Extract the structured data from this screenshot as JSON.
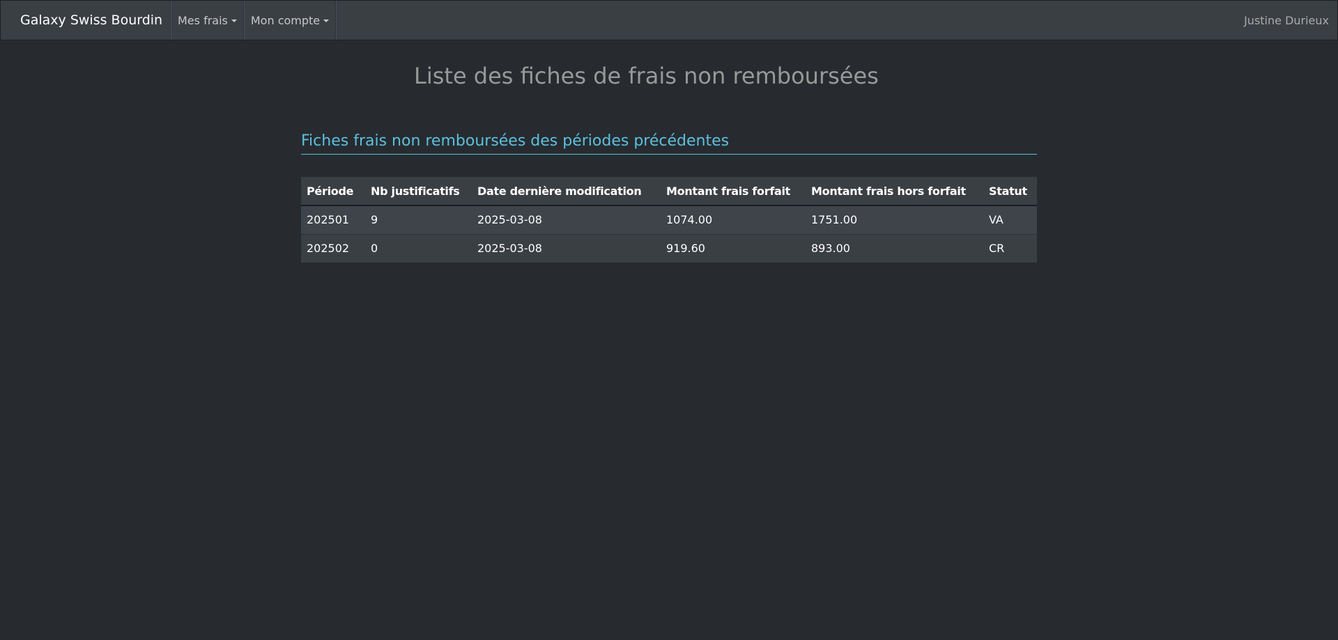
{
  "navbar": {
    "brand": "Galaxy Swiss Bourdin",
    "menus": [
      {
        "label": "Mes frais"
      },
      {
        "label": "Mon compte"
      }
    ],
    "user": "Justine Durieux"
  },
  "page": {
    "title": "Liste des fiches de frais non remboursées"
  },
  "section": {
    "title": "Fiches frais non remboursées des périodes précédentes"
  },
  "table": {
    "headers": [
      "Période",
      "Nb justificatifs",
      "Date dernière modification",
      "Montant frais forfait",
      "Montant frais hors forfait",
      "Statut"
    ],
    "rows": [
      [
        "202501",
        "9",
        "2025-03-08",
        "1074.00",
        "1751.00",
        "VA"
      ],
      [
        "202502",
        "0",
        "2025-03-08",
        "919.60",
        "893.00",
        "CR"
      ]
    ]
  }
}
